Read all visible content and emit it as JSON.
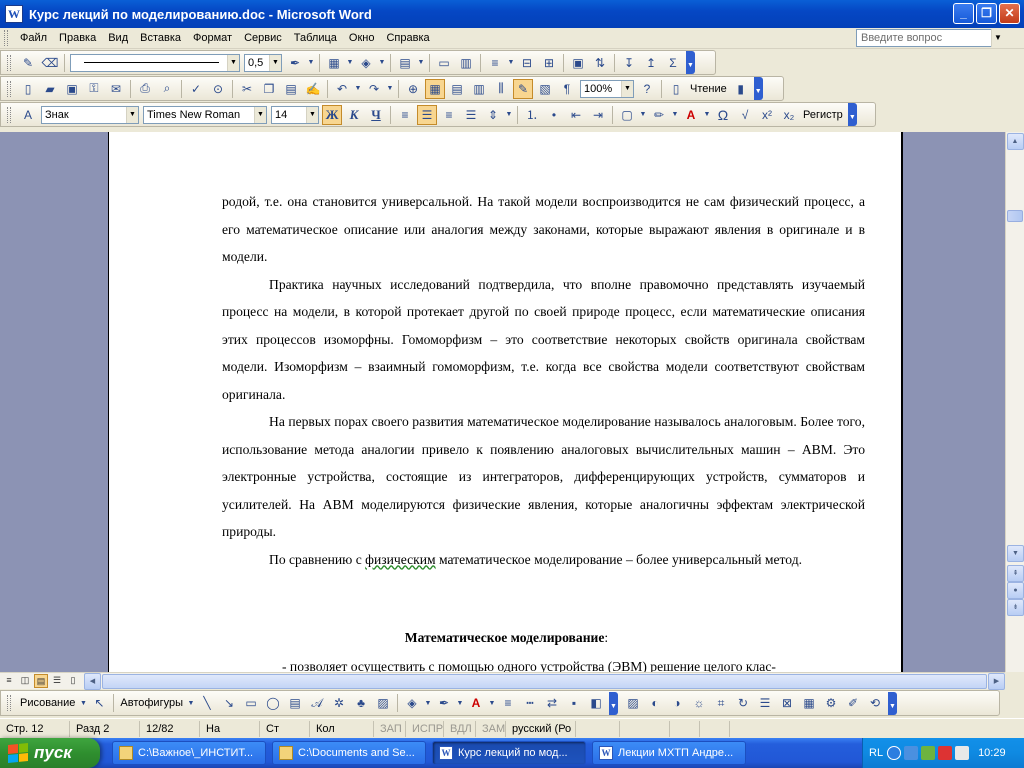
{
  "window": {
    "title": "Курс лекций по моделированию.doc - Microsoft Word",
    "app_icon": "W",
    "minimize": "_",
    "restore": "❐",
    "close": "✕"
  },
  "menu": {
    "items": [
      "Файл",
      "Правка",
      "Вид",
      "Вставка",
      "Формат",
      "Сервис",
      "Таблица",
      "Окно",
      "Справка"
    ],
    "help_placeholder": "Введите вопрос"
  },
  "toolbar_tables": {
    "line_weight": "0,5"
  },
  "toolbar_standard": {
    "zoom": "100%",
    "reading_label": "Чтение"
  },
  "toolbar_format": {
    "style": "Знак",
    "font": "Times New Roman",
    "size": "14",
    "bold": "Ж",
    "italic": "К",
    "underline": "Ч",
    "omega": "Ω",
    "register_label": "Регистр"
  },
  "document": {
    "paragraphs": [
      "родой, т.е. она становится универсальной. На такой модели воспроизводится не сам физический процесс, а его математическое описание или аналогия между законами, которые выражают явления в оригинале и в модели.",
      "Практика научных исследований подтвердила, что вполне правомочно представлять изучаемый процесс на модели, в которой протекает другой по своей природе процесс, если математические описания этих процессов изоморфны. Гомоморфизм – это соответствие некоторых свойств оригинала свойствам модели. Изоморфизм – взаимный гомоморфизм, т.е. когда все свойства модели соответствуют свойствам оригинала.",
      "На первых порах своего развития математическое моделирование называлось аналоговым. Более того, использование метода аналогии привело к появлению аналоговых вычислительных машин – АВМ. Это электронные устройства, состоящие из интеграторов, дифференцирующих устройств, сумматоров и усилителей. На АВМ моделируются физические явления, которые аналогичны эффектам электрической природы."
    ],
    "last_para_start": "По сравнению с ",
    "last_para_underlined": "физическим",
    "last_para_end": " математическое моделирование – более универсальный метод.",
    "heading": "Математическое моделирование",
    "heading_colon": ":",
    "cut_line": "- позволяет осуществить с помощью одного устройства (ЭВМ) решение целого клас-"
  },
  "drawing_toolbar": {
    "draw_label": "Рисование",
    "autoshapes_label": "Автофигуры"
  },
  "status": {
    "page": "Стр. 12",
    "section": "Разд 2",
    "pages": "12/82",
    "at": "На",
    "line": "Ст",
    "col": "Кол",
    "rec": "ЗАП",
    "trk": "ИСПР",
    "ext": "ВДЛ",
    "ovr": "ЗАМ",
    "lang": "русский (Ро"
  },
  "taskbar": {
    "start_label": "пуск",
    "tasks": [
      {
        "label": "C:\\Важное\\_ИНСТИТ...",
        "icon": "folder-icon",
        "active": false
      },
      {
        "label": "C:\\Documents and Se...",
        "icon": "folder-icon",
        "active": false
      },
      {
        "label": "Курс лекций по мод...",
        "icon": "word-icon",
        "active": true
      },
      {
        "label": "Лекции МХТП Андре...",
        "icon": "word-icon",
        "active": false
      }
    ],
    "lang": "RL",
    "clock": "10:29"
  },
  "colors": {
    "title_bar": "#0547c4",
    "doc_background": "#8c93b4",
    "taskbar": "#245edc",
    "start_button": "#2f8f2f",
    "tray": "#0f8ae2"
  }
}
